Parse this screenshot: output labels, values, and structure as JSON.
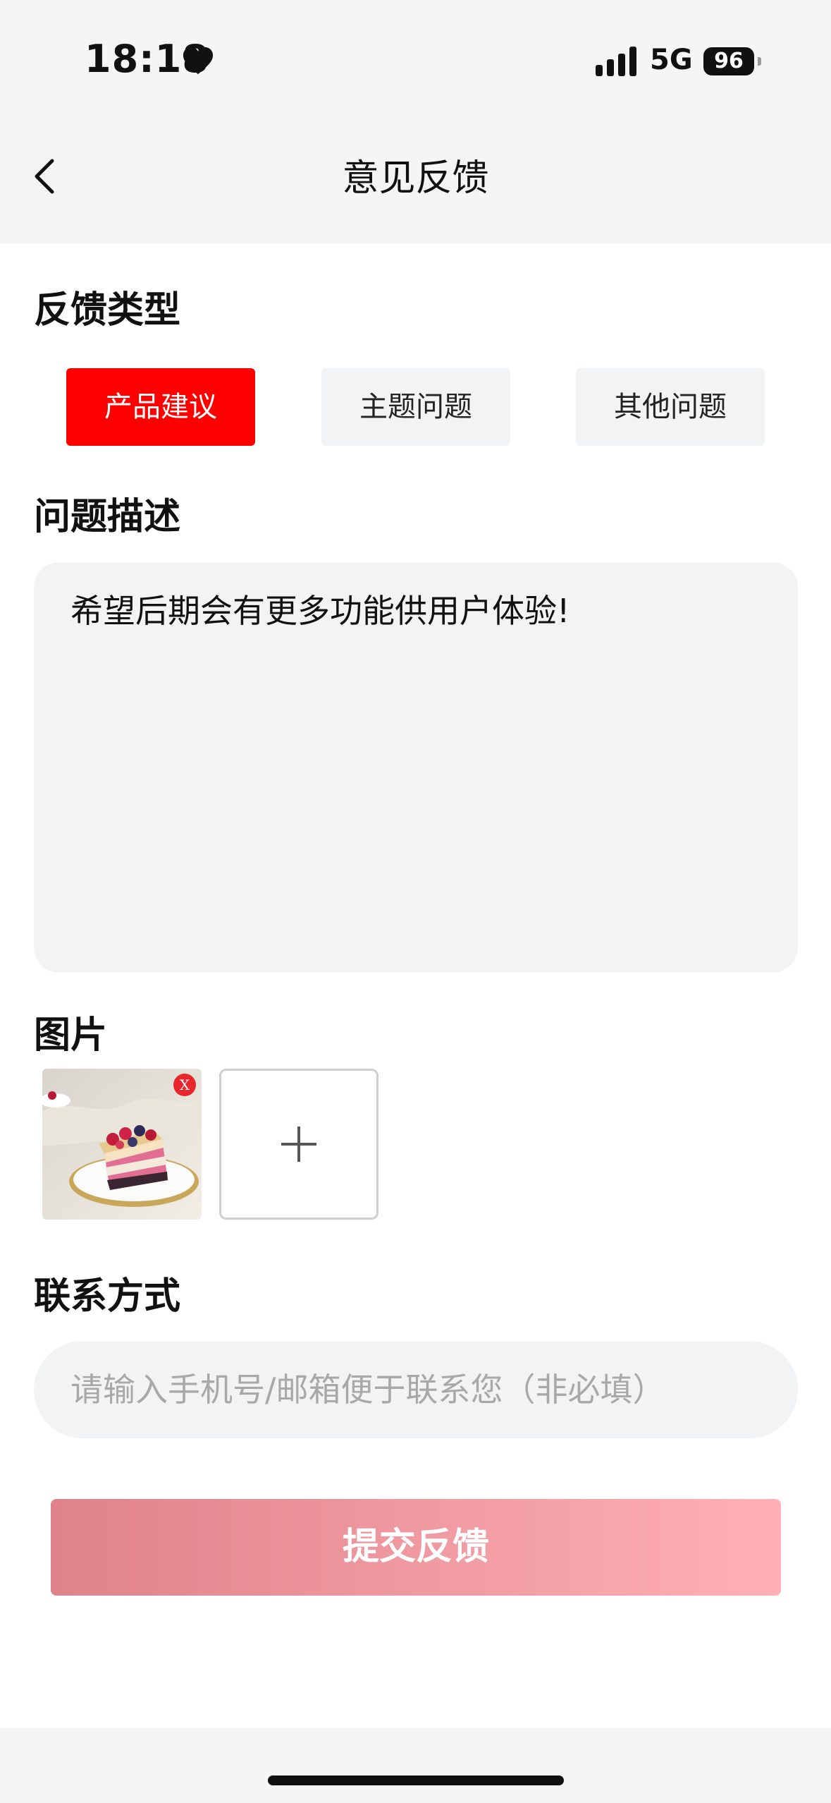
{
  "status_bar": {
    "time": "18:18",
    "network": "5G",
    "battery": "96",
    "icons": [
      "heart-icon",
      "signal-icon",
      "battery-icon"
    ]
  },
  "nav": {
    "title": "意见反馈",
    "back_icon": "chevron-left-icon"
  },
  "feedback_type": {
    "title": "反馈类型",
    "options": [
      {
        "label": "产品建议",
        "selected": true
      },
      {
        "label": "主题问题",
        "selected": false
      },
      {
        "label": "其他问题",
        "selected": false
      }
    ],
    "active_color": "#ff0000"
  },
  "description": {
    "title": "问题描述",
    "value": "希望后期会有更多功能供用户体验!"
  },
  "images": {
    "title": "图片",
    "delete_badge": "X",
    "add_icon": "plus-icon"
  },
  "contact": {
    "title": "联系方式",
    "placeholder": "请输入手机号/邮箱便于联系您（非必填）"
  },
  "submit": {
    "label": "提交反馈",
    "gradient": [
      "#e0828a",
      "#ffb0b6"
    ]
  }
}
